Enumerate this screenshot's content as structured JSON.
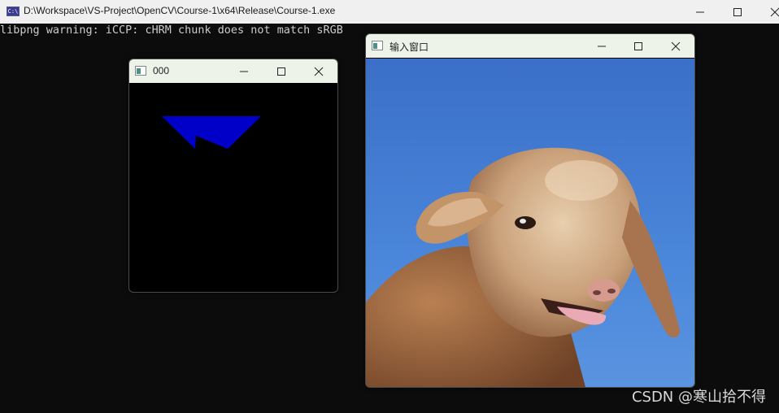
{
  "console": {
    "icon_text": "C:\\",
    "title": "D:\\Workspace\\VS-Project\\OpenCV\\Course-1\\x64\\Release\\Course-1.exe",
    "output": "libpng warning: iCCP: cHRM chunk does not match sRGB"
  },
  "window_000": {
    "title": "000"
  },
  "window_input": {
    "title": "输入窗口"
  },
  "watermark": "CSDN @寒山拾不得",
  "colors": {
    "shape_fill": "#0000c8",
    "sky": "#3f7fd6",
    "console_bg": "#0c0c0c"
  }
}
